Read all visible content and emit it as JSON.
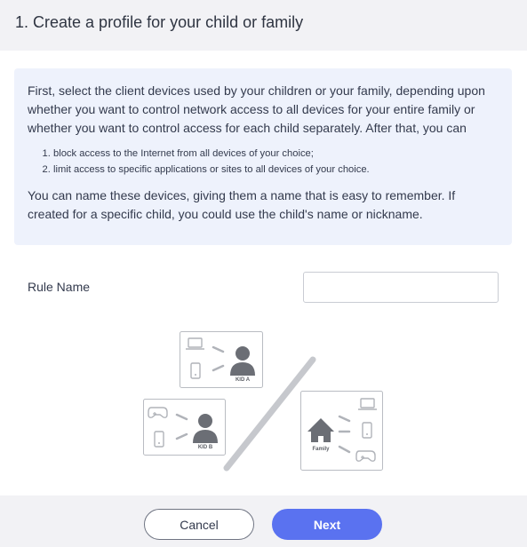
{
  "header": {
    "title": "1. Create a profile for your child or family"
  },
  "info": {
    "paragraph1": "First, select the client devices used by your children or your family, depending upon whether you want to control network access to all devices for your entire family or whether you want to control access for each child separately. After that, you can",
    "steps": [
      "block access to the Internet from all devices of your choice;",
      "limit access to specific applications or sites to all devices of your choice."
    ],
    "paragraph2": "You can name these devices, giving them a name that is easy to remember. If created for a specific child, you could use the child's name or nickname."
  },
  "form": {
    "rule_name_label": "Rule Name",
    "rule_name_value": "",
    "rule_name_placeholder": ""
  },
  "illustration": {
    "kid_a_label": "KID A",
    "kid_b_label": "KID B",
    "family_label": "Family",
    "icons": [
      "laptop-icon",
      "phone-icon",
      "person-icon",
      "gamepad-icon",
      "house-icon"
    ]
  },
  "footer": {
    "cancel_label": "Cancel",
    "next_label": "Next"
  },
  "colors": {
    "primary": "#5a72f0",
    "info_background": "#eef2fc",
    "header_background": "#f2f2f5",
    "text": "#333a4d",
    "illustration_gray": "#b9bcc2",
    "illustration_dark": "#6b6e75"
  }
}
